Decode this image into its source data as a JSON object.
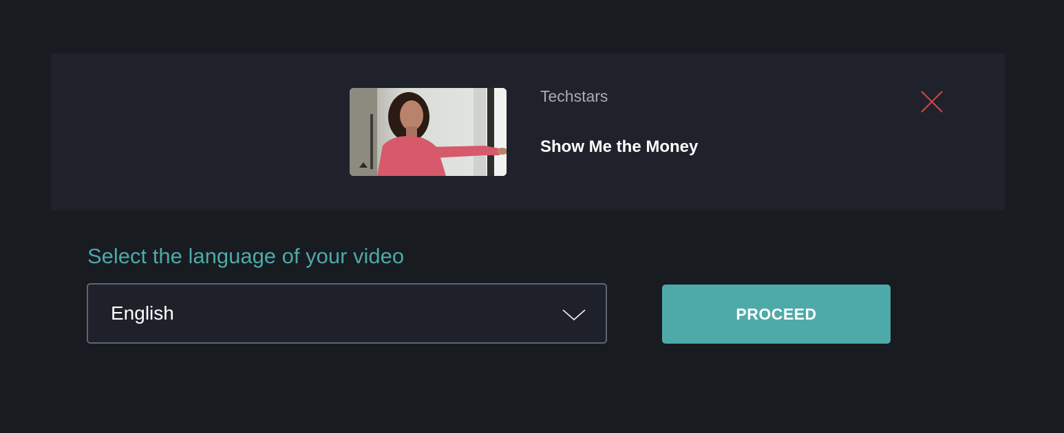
{
  "video": {
    "channel": "Techstars",
    "title": "Show Me the Money",
    "thumbnail_icon": "video-thumbnail-presenter"
  },
  "close_icon": "close-x-icon",
  "language": {
    "label": "Select the language of your video",
    "selected": "English",
    "dropdown_icon": "chevron-down-icon"
  },
  "actions": {
    "proceed_label": "PROCEED"
  },
  "colors": {
    "background": "#181b20",
    "card": "#1f222b",
    "accent": "#4eaaa9",
    "close": "#d64545",
    "select_border": "#5f6675"
  }
}
